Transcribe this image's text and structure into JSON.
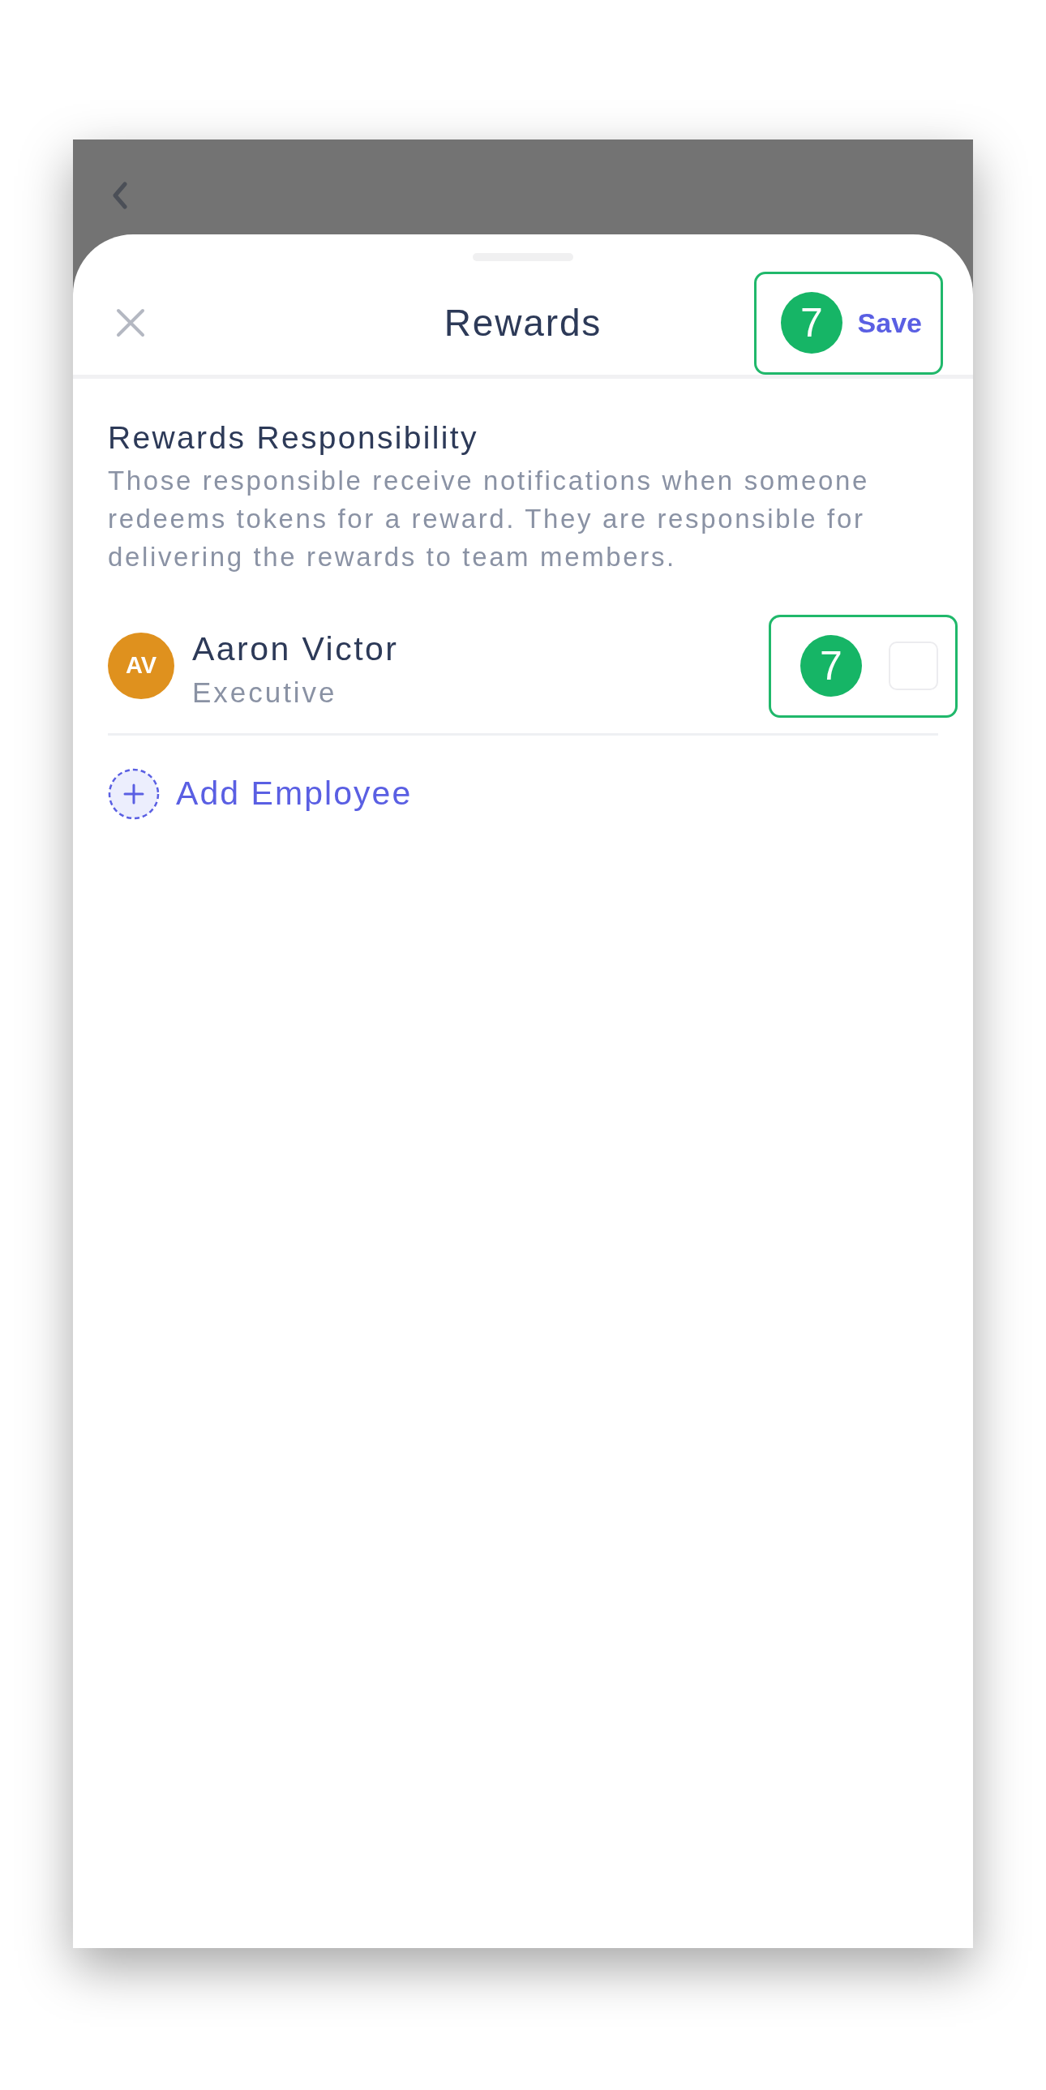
{
  "sheet": {
    "title": "Rewards",
    "save_button": {
      "label": "Save",
      "step_badge": "7"
    }
  },
  "section": {
    "title": "Rewards Responsibility",
    "description": "Those responsible receive notifications when someone redeems tokens for a reward. They are responsible for delivering the rewards to team members."
  },
  "employees": [
    {
      "initials": "AV",
      "name": "Aaron Victor",
      "role": "Executive",
      "color": "#df911e",
      "checked": false,
      "step_badge": "7"
    }
  ],
  "add_button": {
    "label": "Add Employee"
  }
}
